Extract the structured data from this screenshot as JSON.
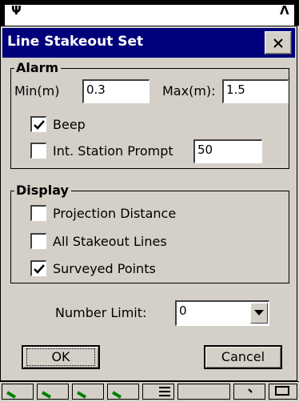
{
  "dialog": {
    "title": "Line Stakeout Set",
    "close_label": "×"
  },
  "alarm": {
    "legend": "Alarm",
    "min_label": "Min(m)",
    "min_value": "0.3",
    "max_label": "Max(m):",
    "max_value": "1.5",
    "beep_label": "Beep",
    "beep_checked": true,
    "station_prompt_label": "Int. Station Prompt",
    "station_prompt_checked": false,
    "station_prompt_value": "50"
  },
  "display": {
    "legend": "Display",
    "items": [
      {
        "label": "Projection Distance",
        "checked": false
      },
      {
        "label": "All Stakeout Lines",
        "checked": false
      },
      {
        "label": "Surveyed Points",
        "checked": true
      }
    ]
  },
  "number_limit": {
    "label": "Number Limit:",
    "value": "0"
  },
  "buttons": {
    "ok": "OK",
    "cancel": "Cancel"
  },
  "colors": {
    "titlebar": "#00007b",
    "face": "#d4d0c8",
    "taskbar_icon": "#008000"
  }
}
